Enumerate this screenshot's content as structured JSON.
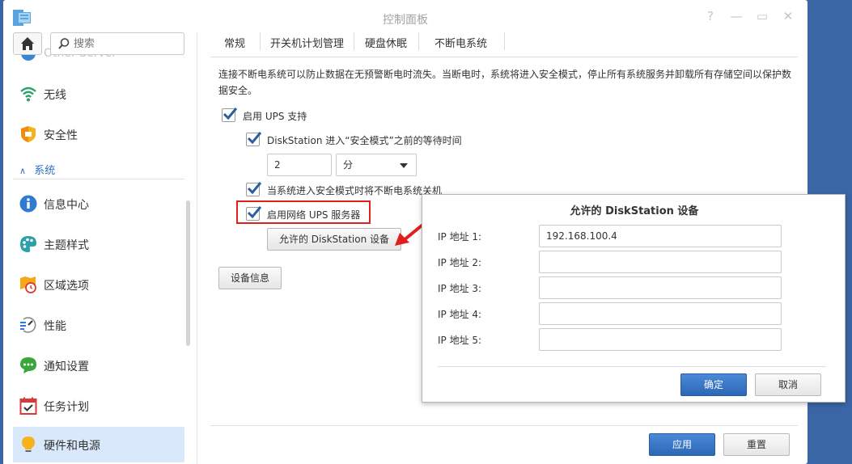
{
  "window": {
    "title": "控制面板",
    "controls": {
      "help": "?",
      "minimize": "—",
      "maximize": "▭",
      "close": "✕"
    }
  },
  "sidebar": {
    "search_placeholder": "搜索",
    "partial_item": "Other Server",
    "section_header": "系统",
    "items": [
      {
        "label": "无线",
        "icon": "wifi-icon"
      },
      {
        "label": "安全性",
        "icon": "shield-icon"
      },
      {
        "label": "信息中心",
        "icon": "info-icon"
      },
      {
        "label": "主题样式",
        "icon": "palette-icon"
      },
      {
        "label": "区域选项",
        "icon": "map-clock-icon"
      },
      {
        "label": "性能",
        "icon": "performance-icon"
      },
      {
        "label": "通知设置",
        "icon": "chat-icon"
      },
      {
        "label": "任务计划",
        "icon": "calendar-check-icon"
      },
      {
        "label": "硬件和电源",
        "icon": "bulb-icon",
        "active": true
      }
    ]
  },
  "tabs": [
    {
      "label": "常规"
    },
    {
      "label": "开关机计划管理"
    },
    {
      "label": "硬盘休眠"
    },
    {
      "label": "不断电系统",
      "active": true
    }
  ],
  "content": {
    "description": "连接不断电系统可以防止数据在无预警断电时流失。当断电时，系统将进入安全模式，停止所有系统服务并卸载所有存储空间以保护数据安全。",
    "enable_ups_label": "启用 UPS 支持",
    "wait_time_label": "DiskStation 进入“安全模式”之前的等待时间",
    "wait_time_value": "2",
    "wait_time_unit": "分",
    "shutdown_ups_label": "当系统进入安全模式时将不断电系统关机",
    "enable_network_ups_label": "启用网络 UPS 服务器",
    "allowed_devices_button": "允许的 DiskStation 设备",
    "device_info_button": "设备信息",
    "apply_button": "应用",
    "reset_button": "重置"
  },
  "dialog": {
    "title": "允许的 DiskStation 设备",
    "fields": [
      {
        "label": "IP 地址 1:",
        "value": "192.168.100.4"
      },
      {
        "label": "IP 地址 2:",
        "value": ""
      },
      {
        "label": "IP 地址 3:",
        "value": ""
      },
      {
        "label": "IP 地址 4:",
        "value": ""
      },
      {
        "label": "IP 地址 5:",
        "value": ""
      }
    ],
    "ok_button": "确定",
    "cancel_button": "取消"
  },
  "colors": {
    "accent": "#2e71c4",
    "highlight_red": "#e0201c",
    "desktop": "#3b66a6",
    "active_nav": "#d9e8fb"
  }
}
